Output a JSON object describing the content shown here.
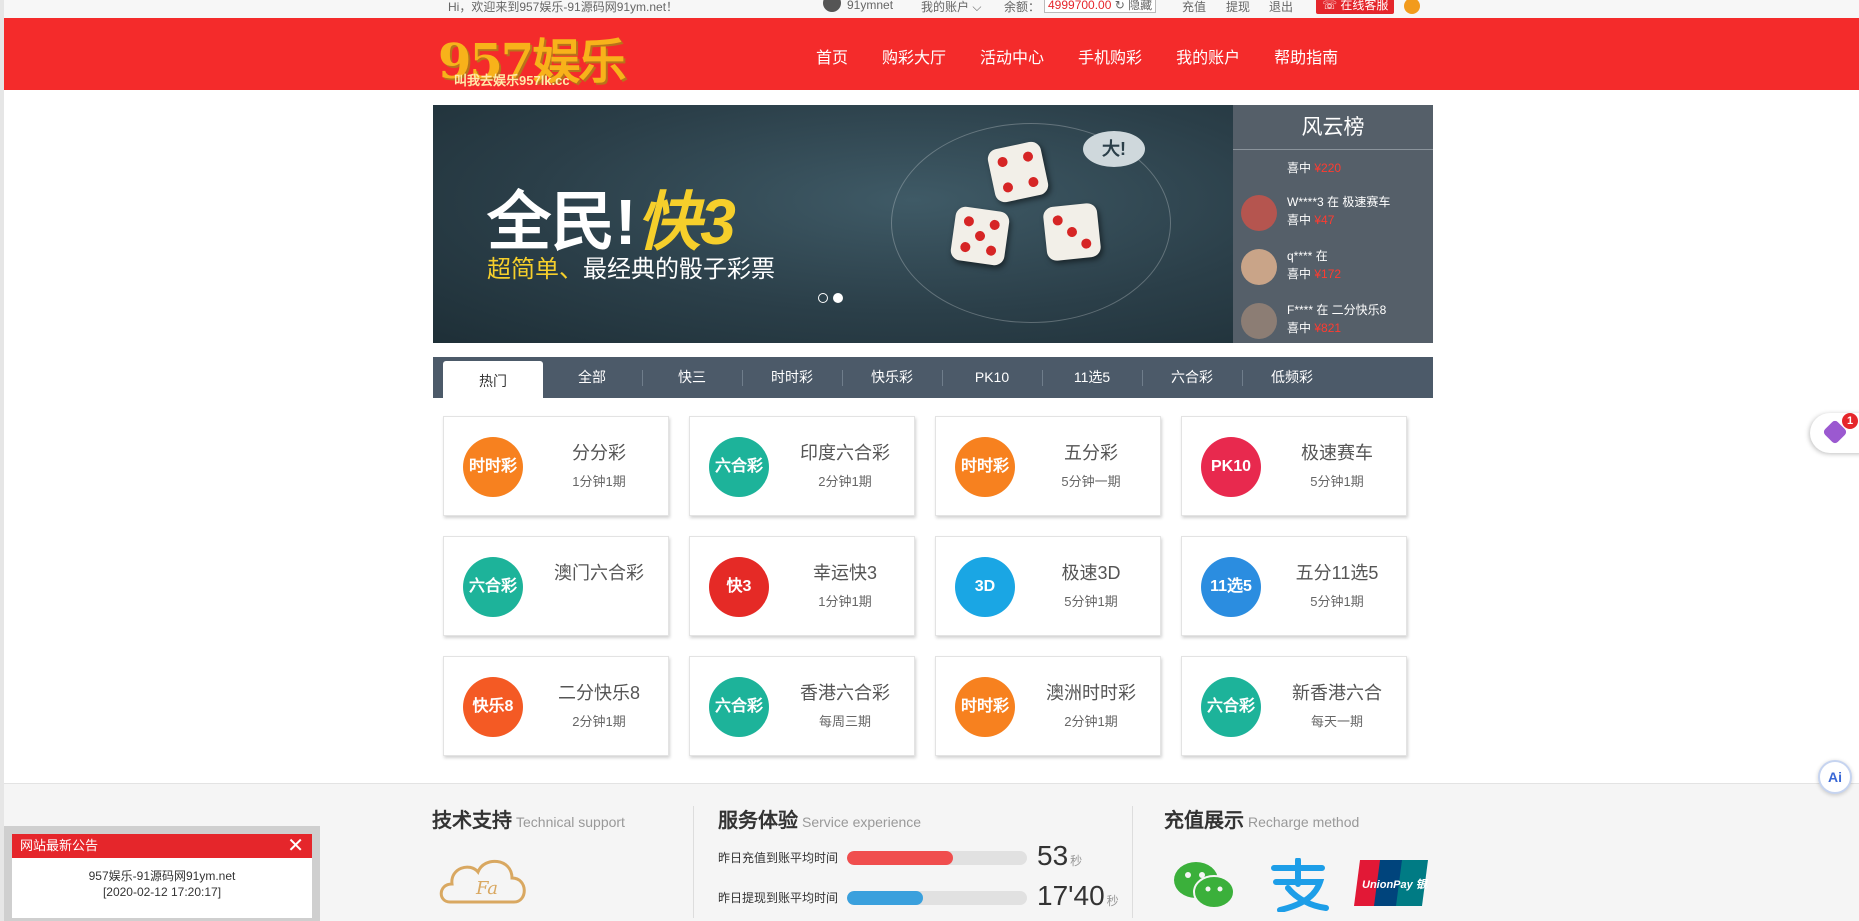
{
  "topbar": {
    "welcome": "Hi，欢迎来到957娱乐-91源码网91ym.net！",
    "username": "91ymnet",
    "my_account": "我的账户",
    "balance_label": "余额：",
    "balance_value": "4999700.00",
    "hide_label": "隐藏",
    "recharge": "充值",
    "withdraw": "提现",
    "logout": "退出",
    "online_service": "在线客服"
  },
  "header": {
    "logo_text": "957娱乐",
    "logo_slogan": "叫我去娱乐957lk.cc",
    "nav": [
      "首页",
      "购彩大厅",
      "活动中心",
      "手机购彩",
      "我的账户",
      "帮助指南"
    ]
  },
  "banner": {
    "headline_part1": "全民!",
    "headline_part2": "快3",
    "sub_highlight": "超简单、",
    "sub_rest": "最经典的骰子彩票",
    "bubble": "大!",
    "slides": 2,
    "active_slide": 2
  },
  "ranking": {
    "title": "风云榜",
    "entries": [
      {
        "line1": "W****3 在 极速赛车",
        "won": "喜中",
        "amount": "¥47"
      },
      {
        "line1": "q**** 在",
        "won": "喜中",
        "amount": "¥172"
      },
      {
        "line1": "F**** 在 二分快乐8",
        "won": "喜中",
        "amount": "¥821"
      }
    ],
    "partial_top": {
      "won": "喜中",
      "amount": "¥220"
    }
  },
  "tabs": [
    "热门",
    "全部",
    "快三",
    "时时彩",
    "快乐彩",
    "PK10",
    "11选5",
    "六合彩",
    "低频彩"
  ],
  "active_tab": "热门",
  "games": [
    {
      "name": "分分彩",
      "freq": "1分钟1期",
      "icon": "时时彩",
      "color": "#f7811f"
    },
    {
      "name": "印度六合彩",
      "freq": "2分钟1期",
      "icon": "六合彩",
      "color": "#1db39a"
    },
    {
      "name": "五分彩",
      "freq": "5分钟一期",
      "icon": "时时彩",
      "color": "#f7811f"
    },
    {
      "name": "极速赛车",
      "freq": "5分钟1期",
      "icon": "PK10",
      "color": "#e8294e"
    },
    {
      "name": "澳门六合彩",
      "freq": "",
      "icon": "六合彩",
      "color": "#1db39a"
    },
    {
      "name": "幸运快3",
      "freq": "1分钟1期",
      "icon": "快3",
      "color": "#e52a26"
    },
    {
      "name": "极速3D",
      "freq": "5分钟1期",
      "icon": "3D",
      "color": "#1aa6e4"
    },
    {
      "name": "五分11选5",
      "freq": "5分钟1期",
      "icon": "11选5",
      "color": "#2b8de0"
    },
    {
      "name": "二分快乐8",
      "freq": "2分钟1期",
      "icon": "快乐8",
      "color": "#f45a24"
    },
    {
      "name": "香港六合彩",
      "freq": "每周三期",
      "icon": "六合彩",
      "color": "#1db39a"
    },
    {
      "name": "澳洲时时彩",
      "freq": "2分钟1期",
      "icon": "时时彩",
      "color": "#f7811f"
    },
    {
      "name": "新香港六合",
      "freq": "每天一期",
      "icon": "六合彩",
      "color": "#1db39a"
    }
  ],
  "footer": {
    "tech_title": "技术支持",
    "tech_en": "Technical support",
    "cloud_text": "Fa",
    "service_title": "服务体验",
    "service_en": "Service experience",
    "recharge_label": "昨日充值到账平均时间",
    "recharge_value": "53",
    "recharge_unit": "秒",
    "recharge_progress": 0.59,
    "withdraw_label": "昨日提现到账平均时间",
    "withdraw_value": "17'40",
    "withdraw_unit": "秒",
    "withdraw_progress": 0.42,
    "pay_title": "充值展示",
    "pay_en": "Recharge method",
    "unionpay_text": "UnionPay 银联"
  },
  "notice": {
    "title": "网站最新公告",
    "close": "✕",
    "line1": "957娱乐-91源码网91ym.net",
    "line2": "[2020-02-12 17:20:17]"
  },
  "side_widget": {
    "badge": "1"
  },
  "ai_button": "Ai",
  "colors": {
    "brand_red": "#f42b2b",
    "tab_bar": "#4c5a69",
    "rank_bg": "#555f69",
    "accent_yellow": "#f6cf2b"
  }
}
